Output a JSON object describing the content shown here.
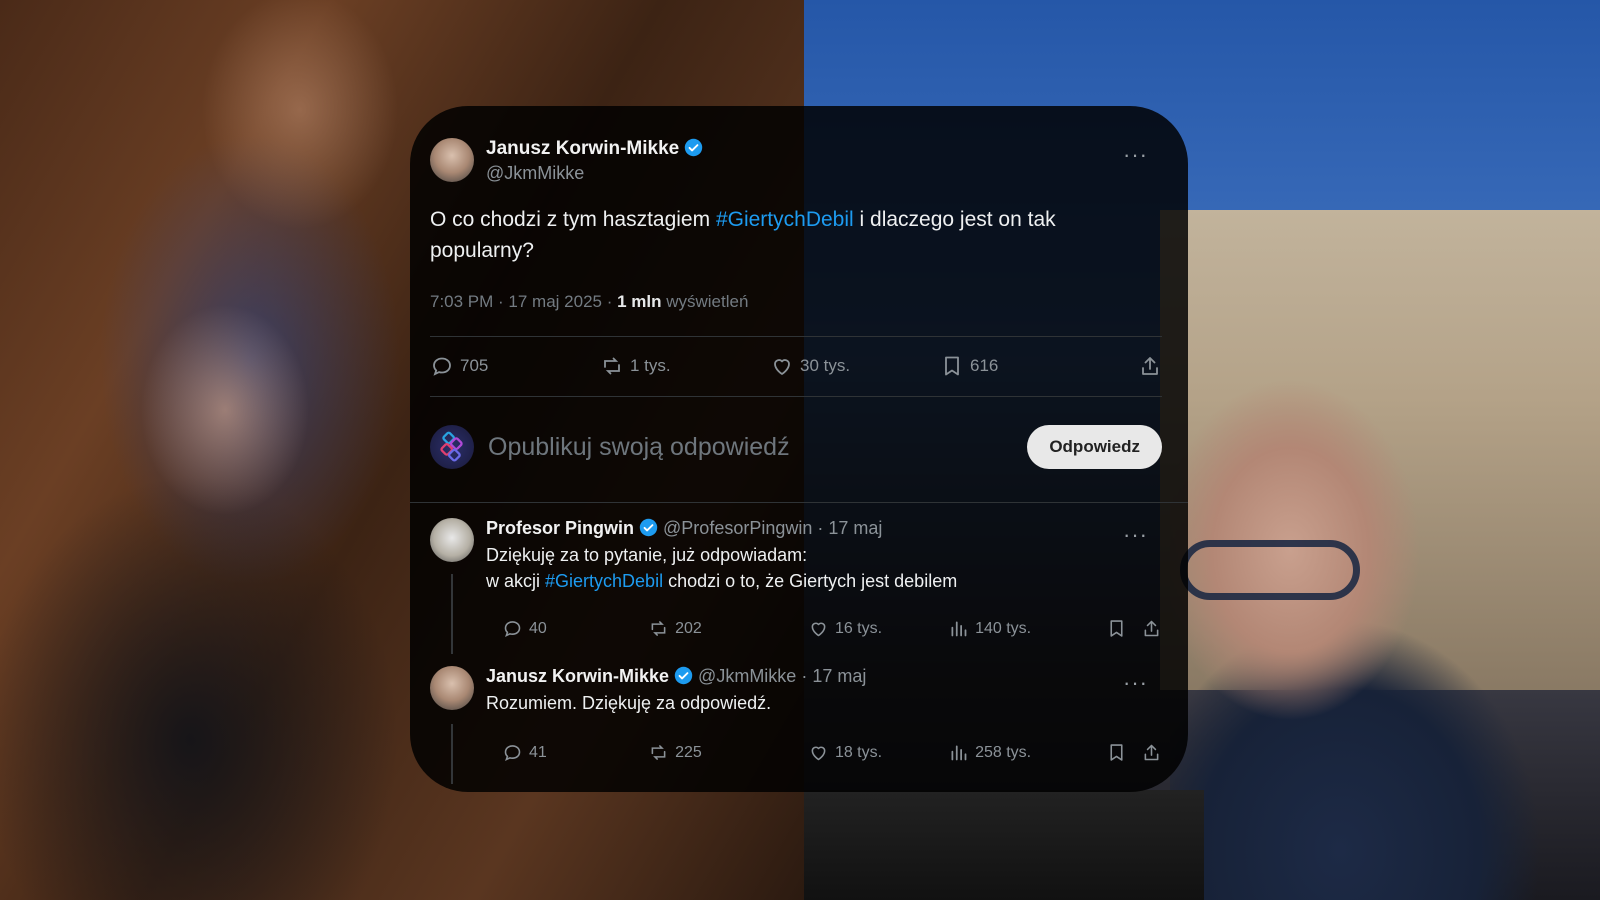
{
  "main_tweet": {
    "author_name": "Janusz Korwin-Mikke",
    "author_handle": "@JkmMikke",
    "text_before": "O co chodzi z tym hasztagiem ",
    "hashtag": "#GiertychDebil",
    "text_after": " i dlaczego jest on tak popularny?",
    "time": "7:03 PM · 17 maj 2025 · ",
    "views_count": "1 mln",
    "views_label": " wyświetleń",
    "replies": "705",
    "reposts": "1 tys.",
    "likes": "30 tys.",
    "bookmarks": "616"
  },
  "reply_box": {
    "placeholder": "Opublikuj swoją odpowiedź",
    "button_label": "Odpowiedz"
  },
  "replies": [
    {
      "name": "Profesor Pingwin",
      "handle_date": " @ProfesorPingwin · 17 maj",
      "line1": "Dziękuję za to pytanie, już odpowiadam:",
      "line2_before": "w akcji ",
      "hashtag": "#GiertychDebil",
      "line2_after": " chodzi o to, że Giertych jest debilem",
      "replies": "40",
      "reposts": "202",
      "likes": "16 tys.",
      "views": "140 tys."
    },
    {
      "name": "Janusz Korwin-Mikke",
      "handle_date": " @JkmMikke · 17 maj",
      "line1": "Rozumiem. Dziękuję za odpowiedź.",
      "replies": "41",
      "reposts": "225",
      "likes": "18 tys.",
      "views": "258 tys."
    }
  ],
  "icons": {
    "more": "···",
    "verified_color": "#1d9bf0"
  }
}
